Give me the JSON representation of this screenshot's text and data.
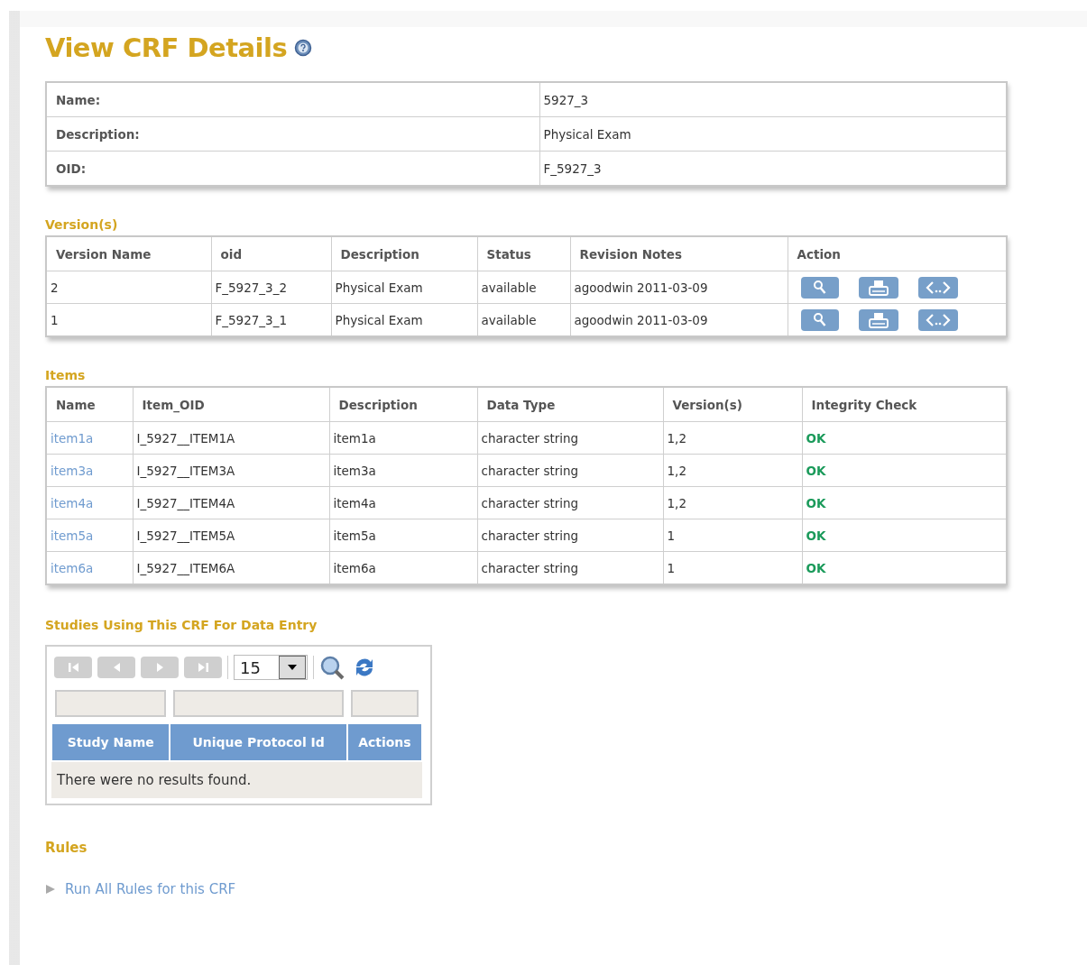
{
  "page_title": "View CRF Details",
  "details": [
    {
      "label": "Name:",
      "value": "5927_3"
    },
    {
      "label": "Description:",
      "value": "Physical Exam"
    },
    {
      "label": "OID:",
      "value": "F_5927_3"
    }
  ],
  "versions": {
    "heading": "Version(s)",
    "columns": [
      "Version Name",
      "oid",
      "Description",
      "Status",
      "Revision Notes",
      "Action"
    ],
    "rows": [
      {
        "cells": [
          "2",
          "F_5927_3_2",
          "Physical Exam",
          "available",
          "agoodwin 2011-03-09"
        ],
        "actions": [
          {
            "kind": "view"
          },
          {
            "kind": "print"
          },
          {
            "kind": "xml"
          }
        ]
      },
      {
        "cells": [
          "1",
          "F_5927_3_1",
          "Physical Exam",
          "available",
          "agoodwin 2011-03-09"
        ],
        "actions": [
          {
            "kind": "view"
          },
          {
            "kind": "print"
          },
          {
            "kind": "xml"
          }
        ]
      }
    ]
  },
  "items": {
    "heading": "Items",
    "columns": [
      "Name",
      "Item_OID",
      "Description",
      "Data Type",
      "Version(s)",
      "Integrity Check"
    ],
    "rows": [
      {
        "name": "item1a",
        "oid": "I_5927__ITEM1A",
        "description": "item1a",
        "data_type": "character string",
        "versions": "1,2",
        "integrity": "OK"
      },
      {
        "name": "item3a",
        "oid": "I_5927__ITEM3A",
        "description": "item3a",
        "data_type": "character string",
        "versions": "1,2",
        "integrity": "OK"
      },
      {
        "name": "item4a",
        "oid": "I_5927__ITEM4A",
        "description": "item4a",
        "data_type": "character string",
        "versions": "1,2",
        "integrity": "OK"
      },
      {
        "name": "item5a",
        "oid": "I_5927__ITEM5A",
        "description": "item5a",
        "data_type": "character string",
        "versions": "1",
        "integrity": "OK"
      },
      {
        "name": "item6a",
        "oid": "I_5927__ITEM6A",
        "description": "item6a",
        "data_type": "character string",
        "versions": "1",
        "integrity": "OK"
      }
    ]
  },
  "studies": {
    "heading": "Studies Using This CRF For Data Entry",
    "pager": [
      {
        "kind": "first",
        "disabled": true
      },
      {
        "kind": "prev",
        "disabled": true
      },
      {
        "kind": "next",
        "disabled": true
      },
      {
        "kind": "last",
        "disabled": true
      }
    ],
    "page_size": "15",
    "columns": [
      "Study Name",
      "Unique Protocol Id",
      "Actions"
    ],
    "empty_message": "There were no results found."
  },
  "rules": {
    "heading": "Rules",
    "link": "Run All Rules for this CRF"
  }
}
